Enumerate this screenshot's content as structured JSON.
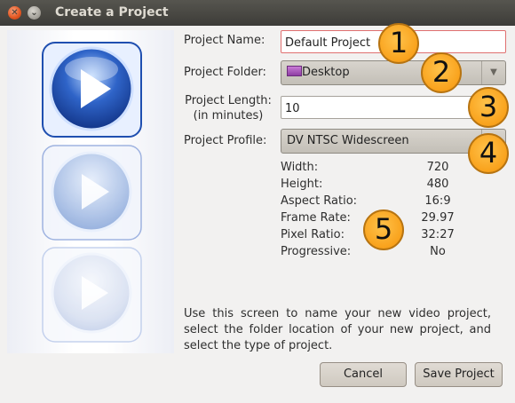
{
  "window": {
    "title": "Create a Project"
  },
  "form": {
    "name_label": "Project Name:",
    "name_value": "Default Project",
    "folder_label": "Project Folder:",
    "folder_value": "Desktop",
    "length_label_line1": "Project Length:",
    "length_label_line2": "(in minutes)",
    "length_value": "10",
    "profile_label": "Project Profile:",
    "profile_value": "DV NTSC Widescreen"
  },
  "profile_info": [
    {
      "key": "Width:",
      "value": "720"
    },
    {
      "key": "Height:",
      "value": "480"
    },
    {
      "key": "Aspect Ratio:",
      "value": "16:9"
    },
    {
      "key": "Frame Rate:",
      "value": "29.97"
    },
    {
      "key": "Pixel Ratio:",
      "value": "32:27"
    },
    {
      "key": "Progressive:",
      "value": "No"
    }
  ],
  "callouts": [
    "1",
    "2",
    "3",
    "4",
    "5"
  ],
  "description": "Use this screen to name your new video project, select the folder location of your new project, and select the type of project.",
  "buttons": {
    "cancel": "Cancel",
    "save": "Save Project"
  },
  "colors": {
    "callout": "#f9a21c",
    "titlebar": "#3d3c38",
    "accent_blue": "#2f64c8"
  }
}
